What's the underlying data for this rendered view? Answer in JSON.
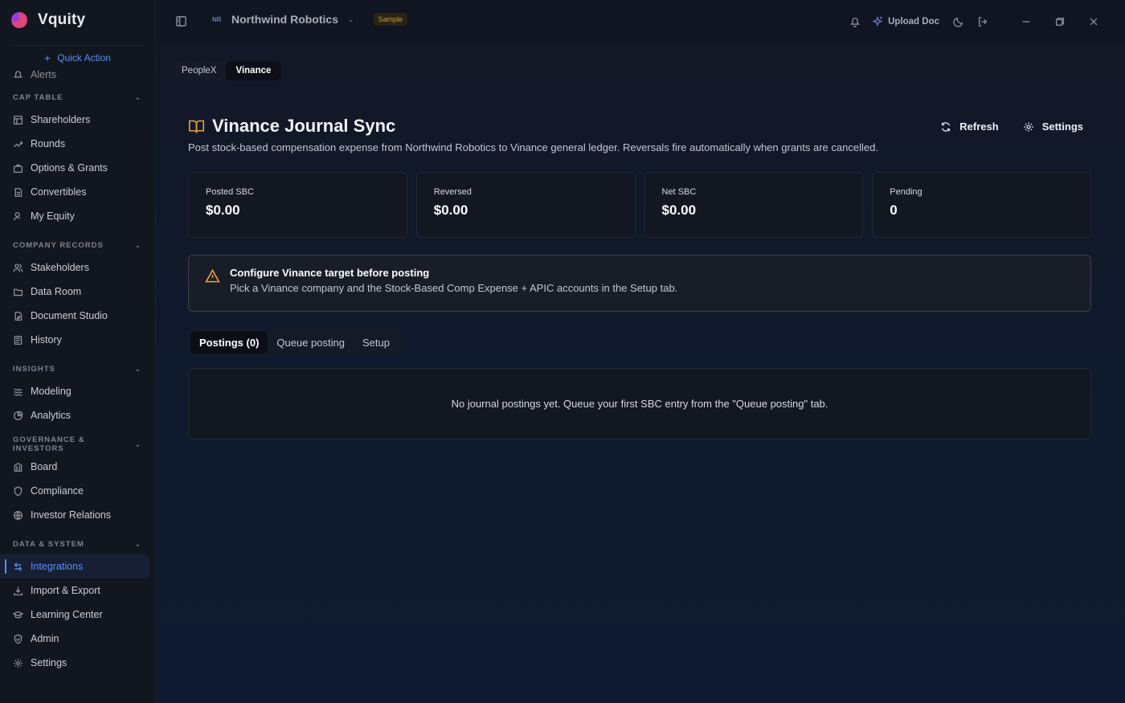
{
  "app": {
    "name": "Vquity",
    "quick_action": "Quick Action"
  },
  "sidebar": {
    "partial_item": "Alerts",
    "sections": [
      {
        "title": "CAP TABLE",
        "items": [
          "Shareholders",
          "Rounds",
          "Options & Grants",
          "Convertibles",
          "My Equity"
        ]
      },
      {
        "title": "COMPANY RECORDS",
        "items": [
          "Stakeholders",
          "Data Room",
          "Document Studio",
          "History"
        ]
      },
      {
        "title": "INSIGHTS",
        "items": [
          "Modeling",
          "Analytics"
        ]
      },
      {
        "title": "GOVERNANCE & INVESTORS",
        "items": [
          "Board",
          "Compliance",
          "Investor Relations"
        ]
      },
      {
        "title": "DATA & SYSTEM",
        "items": [
          "Integrations",
          "Import & Export",
          "Learning Center",
          "Admin",
          "Settings"
        ]
      }
    ],
    "active_item": "Integrations"
  },
  "topbar": {
    "company_initials": "NR",
    "company_name": "Northwind Robotics",
    "badge": "Sample",
    "upload_label": "Upload Doc"
  },
  "integration_tabs": [
    "PeopleX",
    "Vinance"
  ],
  "page": {
    "title": "Vinance Journal Sync",
    "description": "Post stock-based compensation expense from Northwind Robotics to Vinance general ledger. Reversals fire automatically when grants are cancelled.",
    "refresh_label": "Refresh",
    "settings_label": "Settings"
  },
  "stats": [
    {
      "label": "Posted SBC",
      "value": "$0.00"
    },
    {
      "label": "Reversed",
      "value": "$0.00"
    },
    {
      "label": "Net SBC",
      "value": "$0.00"
    },
    {
      "label": "Pending",
      "value": "0"
    }
  ],
  "alert": {
    "title": "Configure Vinance target before posting",
    "text": "Pick a Vinance company and the Stock-Based Comp Expense + APIC accounts in the Setup tab."
  },
  "sub_tabs": [
    "Postings (0)",
    "Queue posting",
    "Setup"
  ],
  "empty_message": "No journal postings yet. Queue your first SBC entry from the \"Queue posting\" tab.",
  "colors": {
    "accent": "#5b8ff0",
    "warning": "#e9a73a",
    "background": "#0f1420"
  }
}
